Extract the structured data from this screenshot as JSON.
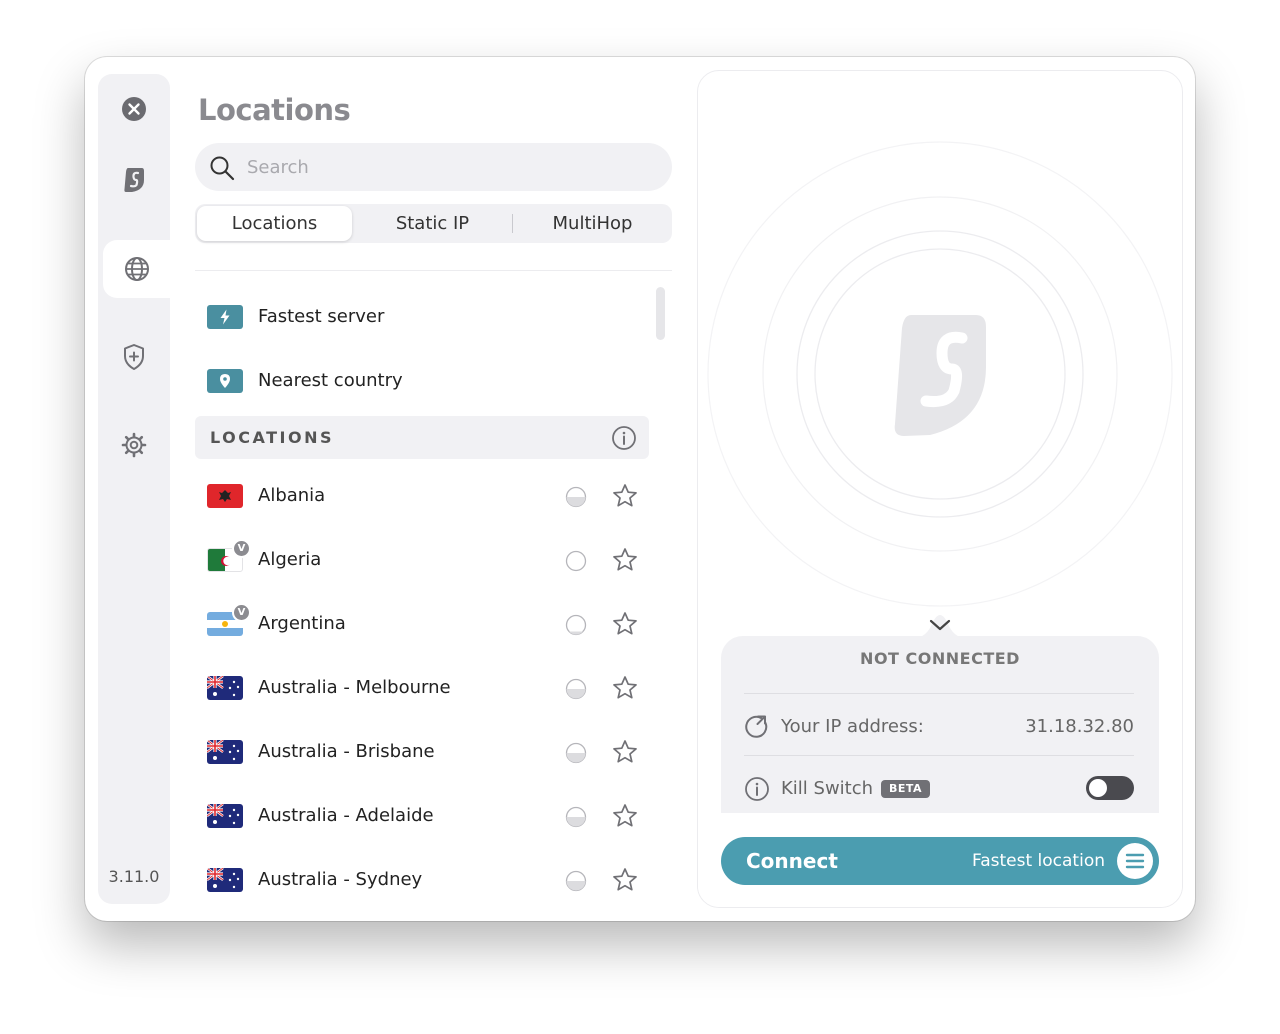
{
  "sidebar": {
    "version": "3.11.0",
    "items": [
      {
        "name": "close-icon"
      },
      {
        "name": "surfshark-logo-icon"
      },
      {
        "name": "globe-icon",
        "active": true
      },
      {
        "name": "shield-plus-icon"
      },
      {
        "name": "gear-icon"
      }
    ]
  },
  "panel": {
    "title": "Locations",
    "search_placeholder": "Search",
    "tabs": [
      "Locations",
      "Static IP",
      "MultiHop"
    ],
    "quick": [
      {
        "label": "Fastest server",
        "icon": "lightning-icon"
      },
      {
        "label": "Nearest country",
        "icon": "pin-icon"
      }
    ],
    "section_header": "LOCATIONS",
    "locations": [
      {
        "label": "Albania",
        "flag": "albania",
        "virtual": false,
        "load": "half"
      },
      {
        "label": "Algeria",
        "flag": "algeria",
        "virtual": true,
        "load": "empty"
      },
      {
        "label": "Argentina",
        "flag": "argentina",
        "virtual": true,
        "load": "low"
      },
      {
        "label": "Australia - Melbourne",
        "flag": "australia",
        "virtual": false,
        "load": "half"
      },
      {
        "label": "Australia - Brisbane",
        "flag": "australia",
        "virtual": false,
        "load": "half"
      },
      {
        "label": "Australia - Adelaide",
        "flag": "australia",
        "virtual": false,
        "load": "half"
      },
      {
        "label": "Australia - Sydney",
        "flag": "australia",
        "virtual": false,
        "load": "half"
      }
    ],
    "virtual_badge": "V"
  },
  "status": {
    "title": "NOT CONNECTED",
    "ip_label": "Your IP address:",
    "ip_value": "31.18.32.80",
    "kill_switch_label": "Kill Switch",
    "kill_switch_badge": "BETA",
    "kill_switch_on": false
  },
  "connect": {
    "label": "Connect",
    "location": "Fastest location"
  },
  "colors": {
    "accent": "#4b9db0",
    "panel_bg": "#f1f1f4",
    "quick_icon": "#4a8fa0"
  }
}
